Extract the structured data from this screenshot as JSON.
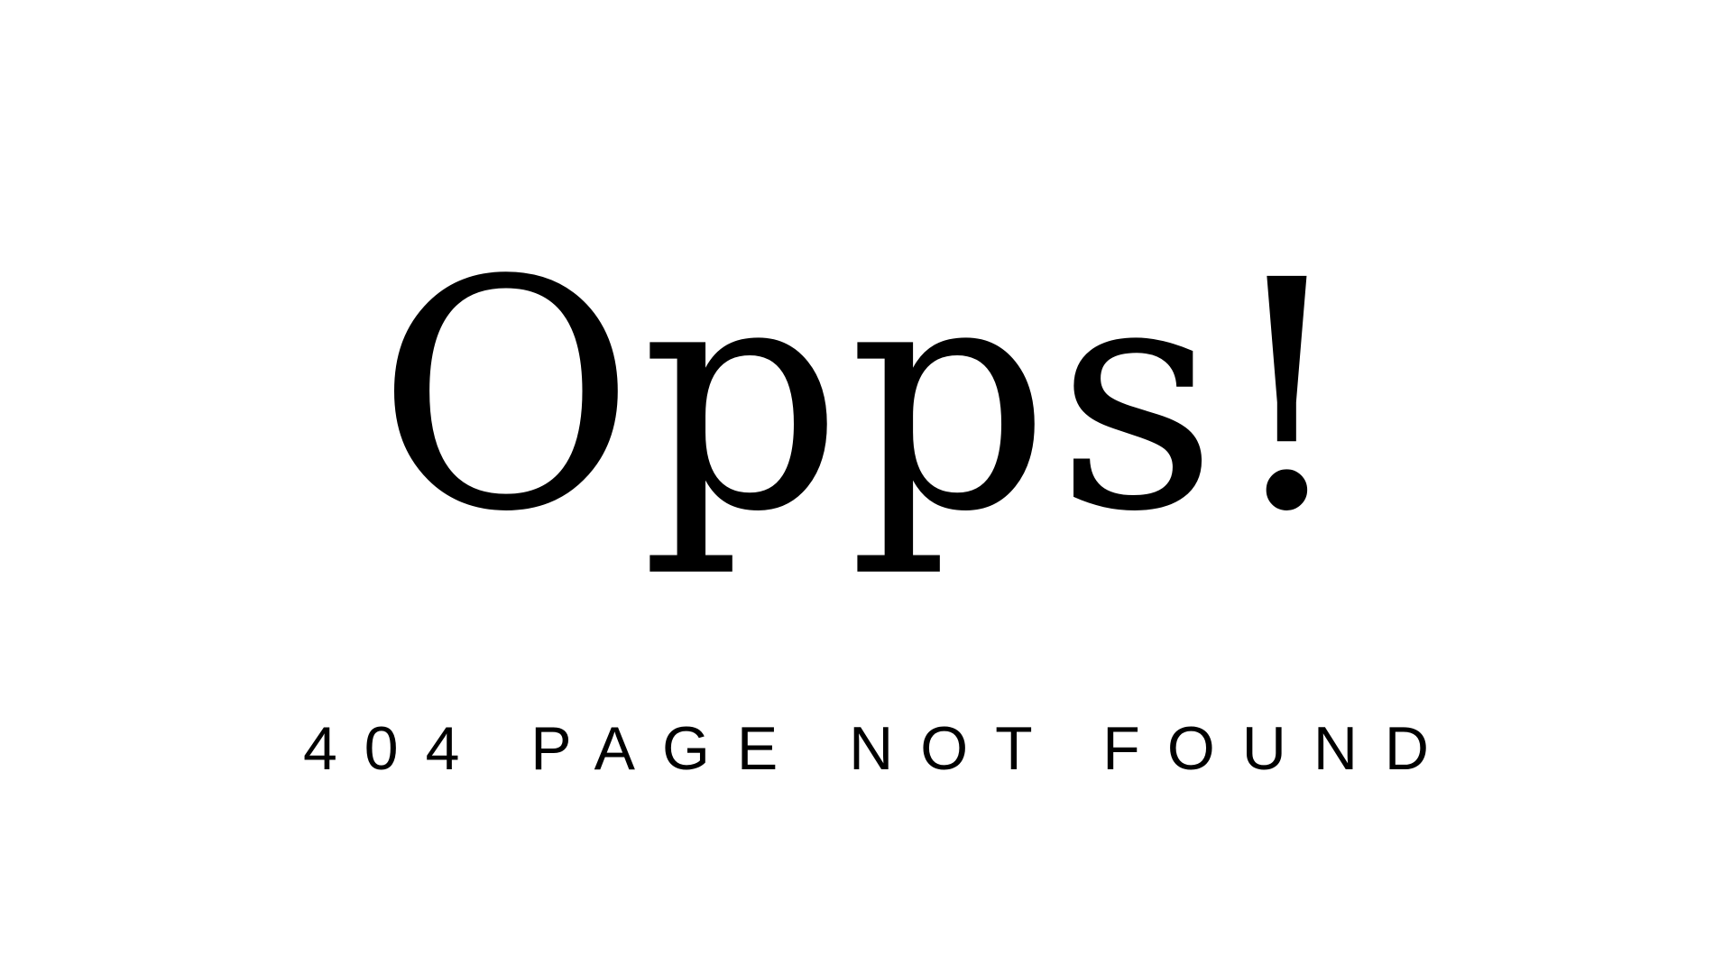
{
  "page": {
    "background_color": "#ffffff",
    "text_color": "#000000",
    "headline": "Opps!",
    "subline": "404 PAGE NOT FOUND"
  }
}
